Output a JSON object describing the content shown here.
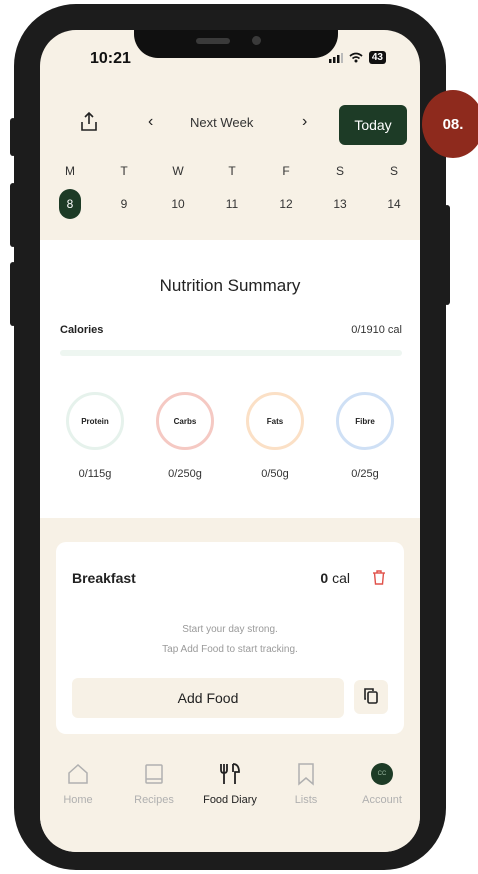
{
  "status_bar": {
    "time": "10:21",
    "battery": "43"
  },
  "week_nav": {
    "label": "Next Week",
    "today_label": "Today"
  },
  "days": [
    {
      "dow": "M",
      "date": "8",
      "selected": true
    },
    {
      "dow": "T",
      "date": "9"
    },
    {
      "dow": "W",
      "date": "10"
    },
    {
      "dow": "T",
      "date": "11"
    },
    {
      "dow": "F",
      "date": "12"
    },
    {
      "dow": "S",
      "date": "13"
    },
    {
      "dow": "S",
      "date": "14"
    }
  ],
  "summary": {
    "title": "Nutrition Summary",
    "calories_label": "Calories",
    "calories_value": "0/1910 cal",
    "calories_progress": 0,
    "macros": [
      {
        "label": "Protein",
        "value": "0/115g",
        "color": "#e6f2ec"
      },
      {
        "label": "Carbs",
        "value": "0/250g",
        "color": "#f5c9c3"
      },
      {
        "label": "Fats",
        "value": "0/50g",
        "color": "#fbe0c6"
      },
      {
        "label": "Fibre",
        "value": "0/25g",
        "color": "#cfe0f5"
      }
    ]
  },
  "meal": {
    "title": "Breakfast",
    "calories": "0",
    "calories_unit": "cal",
    "empty_line1": "Start your day strong.",
    "empty_line2": "Tap Add Food to start tracking.",
    "add_label": "Add Food"
  },
  "tabs": [
    {
      "label": "Home",
      "icon": "home-icon"
    },
    {
      "label": "Recipes",
      "icon": "book-icon"
    },
    {
      "label": "Food Diary",
      "icon": "fork-knife-icon",
      "active": true
    },
    {
      "label": "Lists",
      "icon": "bookmark-icon"
    },
    {
      "label": "Account",
      "icon": "avatar-icon",
      "initials": "CC"
    }
  ],
  "step_badge": "08.",
  "colors": {
    "accent": "#1d3b26",
    "background": "#f7f1e6",
    "badge": "#8e2a1d",
    "trash": "#e0514a"
  }
}
